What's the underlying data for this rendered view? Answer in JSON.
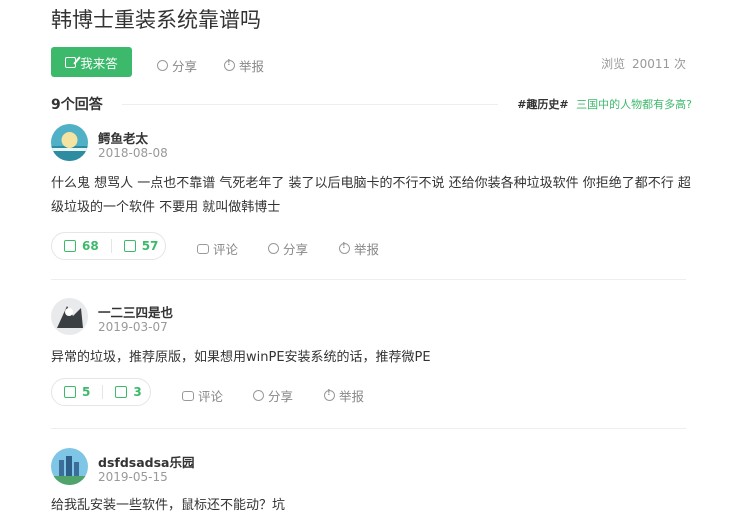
{
  "question": {
    "title": "韩博士重装系统靠谱吗"
  },
  "toolbar": {
    "answer_label": "我来答",
    "share_label": "分享",
    "report_label": "举报"
  },
  "stats": {
    "views_label": "浏览",
    "views_count": "20011 次"
  },
  "answers_header": {
    "count_label": "9个回答",
    "topic_tag": "#趣历史#",
    "topic_link": "三国中的人物都有多高?"
  },
  "answers": [
    {
      "username": "鳄鱼老太",
      "date": "2018-08-08",
      "content": "什么鬼 想骂人 一点也不靠谱 气死老年了 装了以后电脑卡的不行不说 还给你装各种垃圾软件 你拒绝了都不行 超级垃圾的一个软件 不要用 就叫做韩博士",
      "upvotes": "68",
      "downvotes": "57",
      "comment_label": "评论",
      "share_label": "分享",
      "report_label": "举报"
    },
    {
      "username": "一二三四是也",
      "date": "2019-03-07",
      "content": "异常的垃圾，推荐原版，如果想用winPE安装系统的话，推荐微PE",
      "upvotes": "5",
      "downvotes": "3",
      "comment_label": "评论",
      "share_label": "分享",
      "report_label": "举报"
    },
    {
      "username": "dsfdsadsa乐园",
      "date": "2019-05-15",
      "content": "给我乱安装一些软件，鼠标还不能动？坑"
    }
  ],
  "colors": {
    "accent": "#3db96c",
    "muted": "#999999"
  }
}
